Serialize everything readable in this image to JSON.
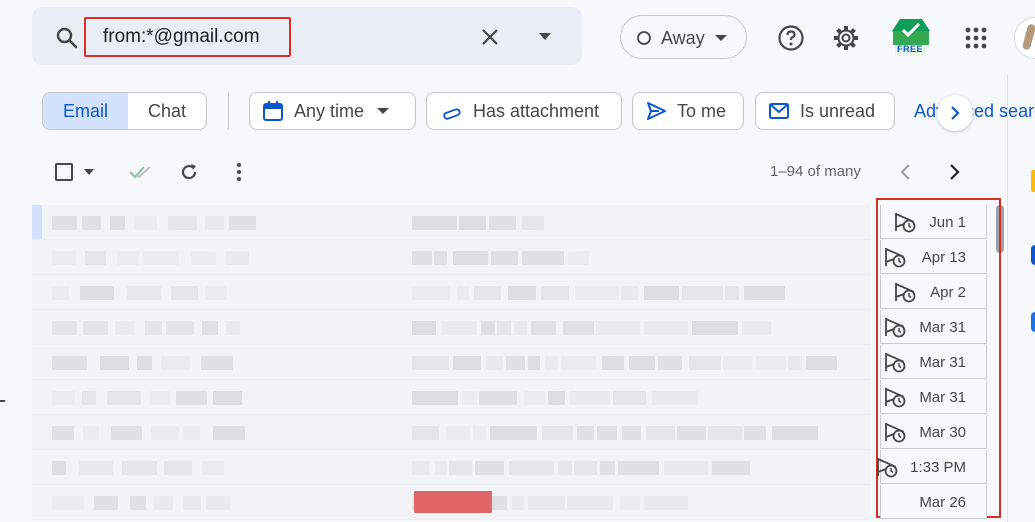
{
  "search": {
    "query": "from:*@gmail.com"
  },
  "header": {
    "status_label": "Away",
    "free_badge": "FREE"
  },
  "filters": {
    "tabs": [
      {
        "label": "Email",
        "active": true
      },
      {
        "label": "Chat",
        "active": false
      }
    ],
    "chips": [
      {
        "label": "Any time",
        "icon": "calendar-icon"
      },
      {
        "label": "Has attachment",
        "icon": "paperclip-icon"
      },
      {
        "label": "To me",
        "icon": "send-arrow-icon"
      },
      {
        "label": "Is unread",
        "icon": "envelope-icon"
      }
    ],
    "advanced_search_label": "Advanced search"
  },
  "toolbar": {
    "pagination": "1–94 of many"
  },
  "messages": [
    {
      "date": "Jun 1",
      "snoozed": true
    },
    {
      "date": "Apr 13",
      "snoozed": true
    },
    {
      "date": "Apr 2",
      "snoozed": true
    },
    {
      "date": "Mar 31",
      "snoozed": true
    },
    {
      "date": "Mar 31",
      "snoozed": true
    },
    {
      "date": "Mar 31",
      "snoozed": true
    },
    {
      "date": "Mar 30",
      "snoozed": true
    },
    {
      "date": "1:33 PM",
      "snoozed": true
    },
    {
      "date": "Mar 26",
      "snoozed": false
    }
  ],
  "colors": {
    "accent": "#0b57d0",
    "highlight": "#d93025",
    "bg": "#f6f8fc",
    "search_bg": "#e9eef6"
  }
}
